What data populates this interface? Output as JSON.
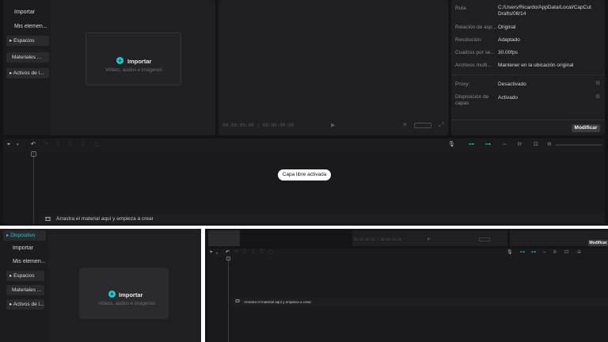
{
  "media": {
    "nav": {
      "dispositivo": "Dispositivo",
      "importar": "Importar",
      "mis_elementos": "Mis elemen...",
      "espacios": "Espacios",
      "materiales": "Materiales ...",
      "activos": "Activos de l..."
    },
    "import": {
      "label": "Importar",
      "subtitle": "Videos, audios e imágenes"
    }
  },
  "player": {
    "time_current": "00:00:00:00",
    "time_total": "00:00:00:00"
  },
  "properties": {
    "rows": [
      {
        "label": "Ruta",
        "value": "C:/Users/Ricardo/AppData/Local/CapCut Drafts/08/14"
      },
      {
        "label": "Relación de asp...",
        "value": "Original"
      },
      {
        "label": "Resolución:",
        "value": "Adaptado"
      },
      {
        "label": "Cuadros por se...",
        "value": "30.00fps"
      },
      {
        "label": "Archivos multi...",
        "value": "Mantener en la ubicación original"
      },
      {
        "label": "Proxy:",
        "value": "Desactivado"
      },
      {
        "label": "Disposición de capas",
        "value": "Activado"
      }
    ],
    "modify_button": "Modificar"
  },
  "timeline": {
    "toast": "Capa libre activada",
    "drop_hint": "Arrastra el material aquí y empieza a crear"
  },
  "colors": {
    "accent": "#1ec9d4",
    "panel_bg": "#1f1f22",
    "window_bg": "#141416"
  }
}
